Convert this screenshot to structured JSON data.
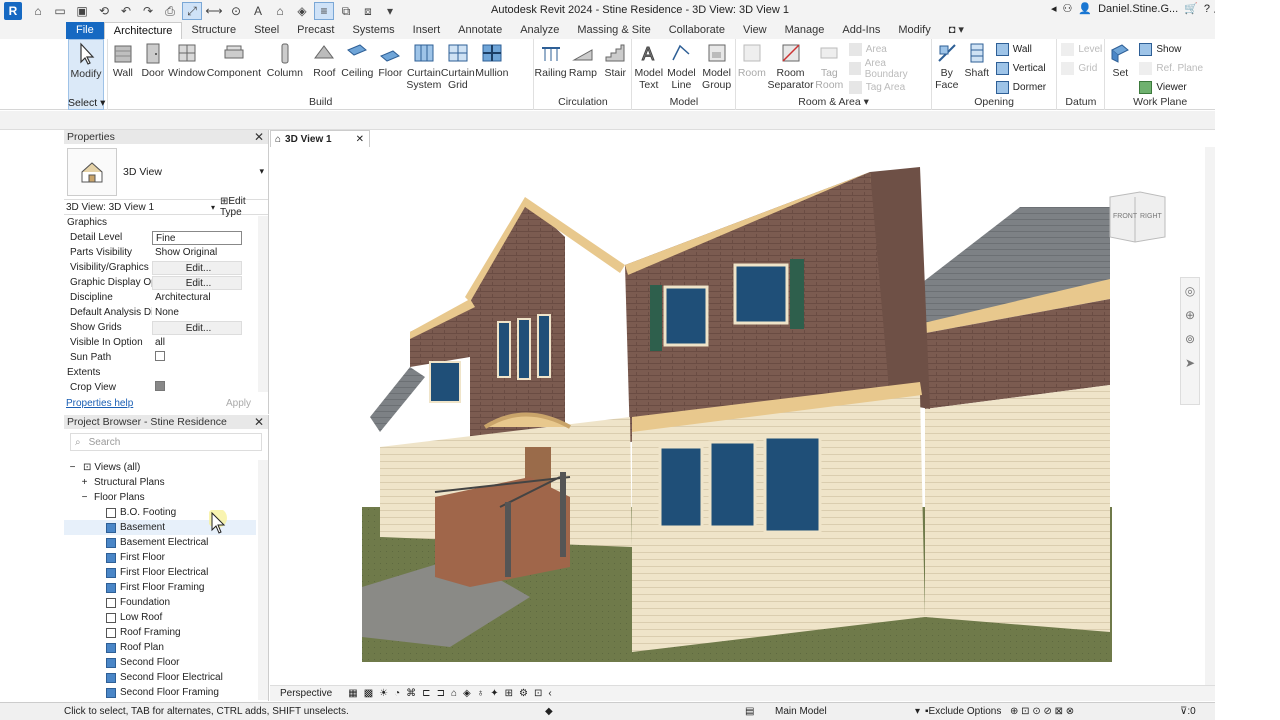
{
  "window": {
    "title": "Autodesk Revit 2024 - Stine Residence - 3D View: 3D View 1",
    "user": "Daniel.Stine.G...",
    "app_logo": "R"
  },
  "tabs": [
    "File",
    "Architecture",
    "Structure",
    "Steel",
    "Precast",
    "Systems",
    "Insert",
    "Annotate",
    "Analyze",
    "Massing & Site",
    "Collaborate",
    "View",
    "Manage",
    "Add-Ins",
    "Modify"
  ],
  "ribbon": {
    "select": "Select",
    "modify": "Modify",
    "build": {
      "label": "Build",
      "tools": [
        "Wall",
        "Door",
        "Window",
        "Component",
        "Column",
        "Roof",
        "Ceiling",
        "Floor",
        "Curtain System",
        "Curtain Grid",
        "Mullion"
      ]
    },
    "circulation": {
      "label": "Circulation",
      "tools": [
        "Railing",
        "Ramp",
        "Stair"
      ]
    },
    "model": {
      "label": "Model",
      "tools": [
        "Model Text",
        "Model Line",
        "Model Group"
      ]
    },
    "room_area": {
      "label": "Room & Area",
      "tools": [
        "Room",
        "Room Separator",
        "Tag Room"
      ],
      "small": [
        "Area",
        "Area Boundary",
        "Tag Area"
      ]
    },
    "opening": {
      "label": "Opening",
      "tools": [
        "By Face",
        "Shaft"
      ],
      "small": [
        "Wall",
        "Vertical",
        "Dormer"
      ]
    },
    "datum": {
      "label": "Datum",
      "small": [
        "Level",
        "Grid"
      ]
    },
    "work_plane": {
      "label": "Work Plane",
      "tools": [
        "Set"
      ],
      "small": [
        "Show",
        "Ref. Plane",
        "Viewer"
      ]
    }
  },
  "properties": {
    "title": "Properties",
    "type_name": "3D View",
    "instance": "3D View: 3D View 1",
    "edit_type": "Edit Type",
    "section_graphics": "Graphics",
    "rows": [
      {
        "key": "Detail Level",
        "value": "Fine",
        "kind": "box"
      },
      {
        "key": "Parts Visibility",
        "value": "Show Original",
        "kind": "text"
      },
      {
        "key": "Visibility/Graphics ...",
        "value": "Edit...",
        "kind": "btn"
      },
      {
        "key": "Graphic Display Op...",
        "value": "Edit...",
        "kind": "btn"
      },
      {
        "key": "Discipline",
        "value": "Architectural",
        "kind": "text"
      },
      {
        "key": "Default Analysis Di...",
        "value": "None",
        "kind": "text"
      },
      {
        "key": "Show Grids",
        "value": "Edit...",
        "kind": "btn"
      },
      {
        "key": "Visible In Option",
        "value": "all",
        "kind": "text"
      },
      {
        "key": "Sun Path",
        "value": "",
        "kind": "chk"
      }
    ],
    "section_extents": "Extents",
    "crop_view": "Crop View",
    "help": "Properties help",
    "apply": "Apply"
  },
  "browser": {
    "title": "Project Browser - Stine Residence",
    "search_placeholder": "Search",
    "views_all": "Views (all)",
    "structural_plans": "Structural Plans",
    "floor_plans": "Floor Plans",
    "items": [
      "B.O. Footing",
      "Basement",
      "Basement Electrical",
      "First Floor",
      "First Floor Electrical",
      "First Floor Framing",
      "Foundation",
      "Low Roof",
      "Roof Framing",
      "Roof Plan",
      "Second Floor",
      "Second Floor Electrical",
      "Second Floor Framing"
    ]
  },
  "view_tab": "3D View 1",
  "viewcube": {
    "front": "FRONT",
    "right": "RIGHT"
  },
  "view_control": {
    "projection": "Perspective"
  },
  "status": {
    "hint": "Click to select, TAB for alternates, CTRL adds, SHIFT unselects.",
    "model": "Main Model",
    "exclude": "Exclude Options",
    "filter_count": ":0"
  },
  "colors": {
    "brick": "#7a5a4f",
    "siding": "#efe3c8",
    "trim": "#e9c98e",
    "shutter": "#2e5f4c",
    "grass": "#6f7a4a",
    "roof": "#7a7d80"
  }
}
